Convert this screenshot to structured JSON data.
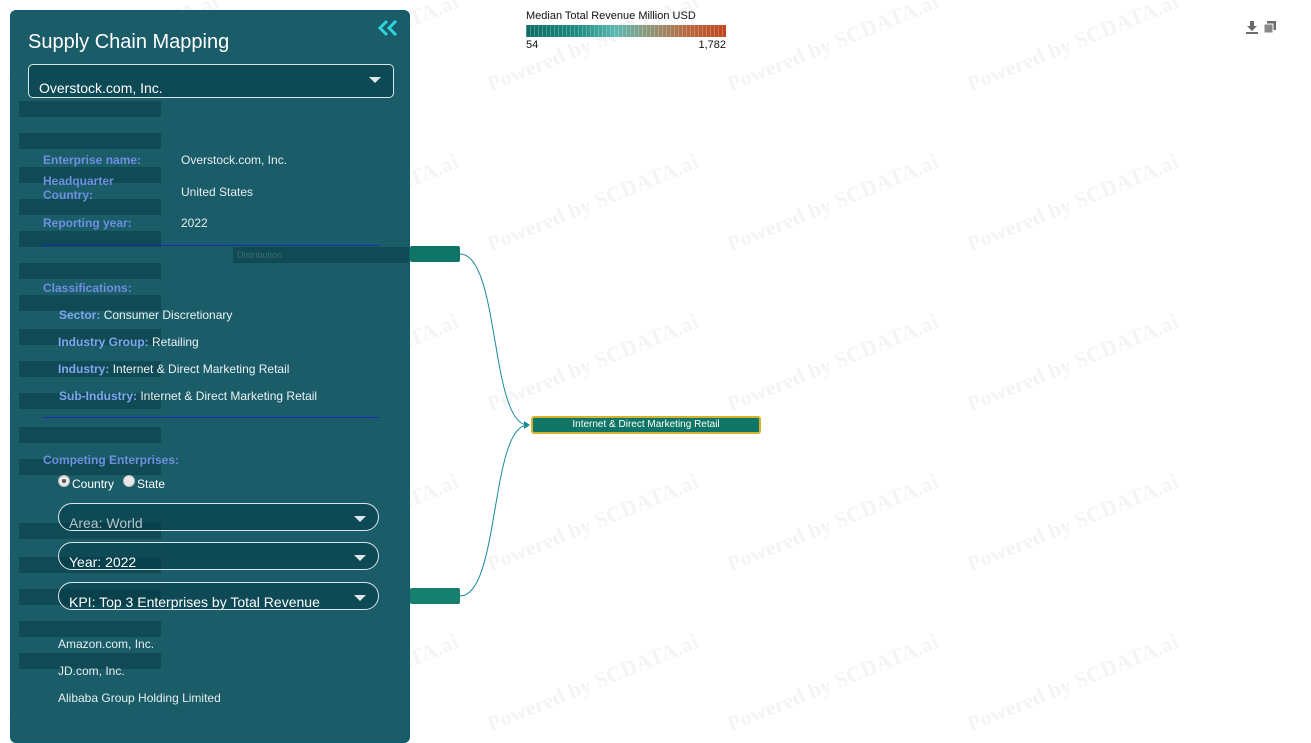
{
  "watermark": "Powered by SCDATA.ai",
  "legend": {
    "title": "Median Total Revenue Million USD",
    "min": "54",
    "max": "1,782",
    "colors": [
      "#0d6b63",
      "#5cb8b0",
      "#c0441a"
    ]
  },
  "toolbar": {
    "download_icon": "download-icon",
    "copy_icon": "copy-icon"
  },
  "graph": {
    "node_label": "Internet & Direct Marketing Retail",
    "ghost_label": "Distribution",
    "link_color": "#1a8a99",
    "node_color": "#0f7567",
    "highlight_color": "#d4b22a"
  },
  "panel": {
    "title": "Supply Chain Mapping",
    "collapse_icon": "double-chevron-left-icon",
    "company_select": "Overstock.com, Inc.",
    "enterprise_name_label": "Enterprise name:",
    "enterprise_name": "Overstock.com, Inc.",
    "hq_country_label_1": "Headquarter",
    "hq_country_label_2": "Country:",
    "hq_country": "United States",
    "reporting_year_label": "Reporting year:",
    "reporting_year": "2022",
    "classifications_label": "Classifications:",
    "sector_label": "Sector:",
    "sector": "Consumer Discretionary",
    "industry_group_label": "Industry Group:",
    "industry_group": "Retailing",
    "industry_label": "Industry:",
    "industry": "Internet & Direct Marketing Retail",
    "sub_industry_label": "Sub-Industry:",
    "sub_industry": "Internet & Direct Marketing Retail",
    "competing_label": "Competing Enterprises:",
    "radio_country": "Country",
    "radio_state": "State",
    "area_select": "Area: World",
    "year_select": "Year: 2022",
    "kpi_select": "KPI: Top 3 Enterprises by Total Revenue",
    "competitors": [
      "Amazon.com, Inc.",
      "JD.com, Inc.",
      "Alibaba Group Holding Limited"
    ]
  }
}
